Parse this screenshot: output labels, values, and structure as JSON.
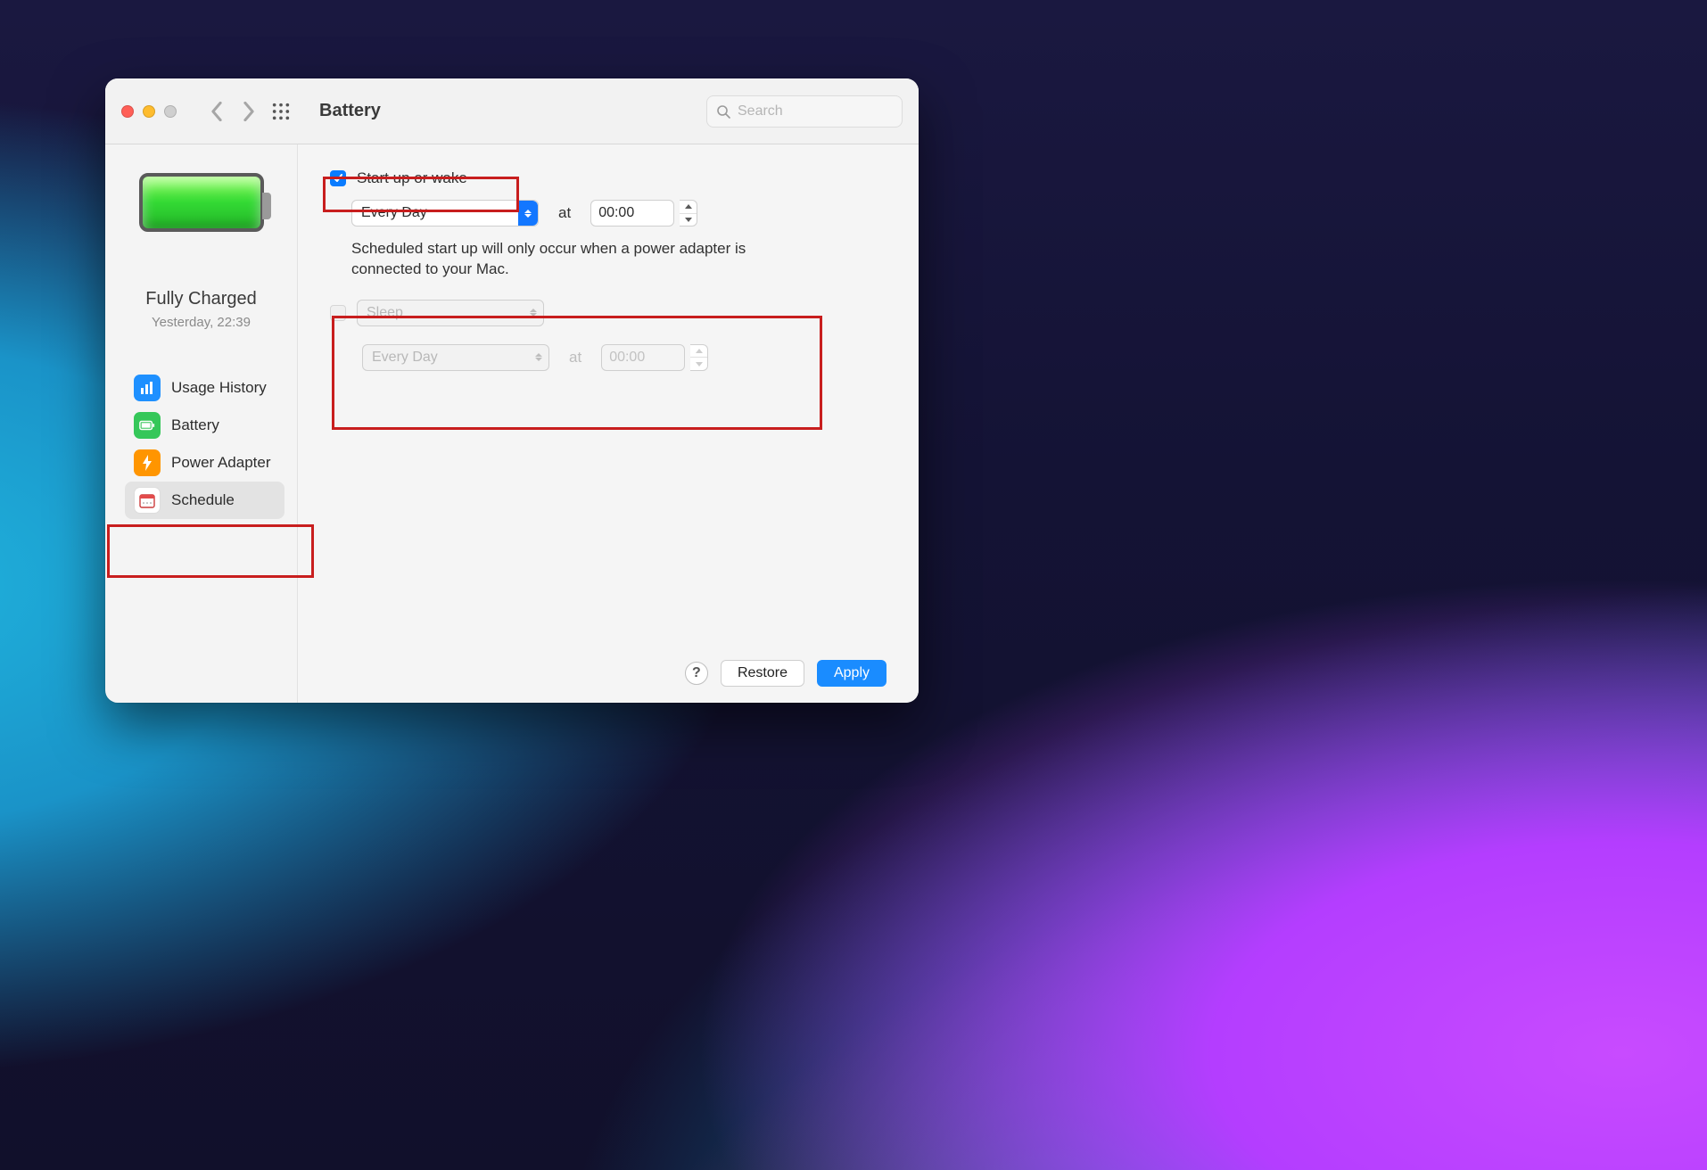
{
  "header": {
    "title": "Battery",
    "search_placeholder": "Search"
  },
  "sidebar": {
    "status_title": "Fully Charged",
    "status_sub": "Yesterday, 22:39",
    "items": [
      {
        "label": "Usage History",
        "icon": "chart-icon",
        "selected": false
      },
      {
        "label": "Battery",
        "icon": "battery-icon",
        "selected": false
      },
      {
        "label": "Power Adapter",
        "icon": "bolt-icon",
        "selected": false
      },
      {
        "label": "Schedule",
        "icon": "calendar-icon",
        "selected": true
      }
    ]
  },
  "schedule": {
    "startup": {
      "checked": true,
      "label": "Start up or wake",
      "frequency": "Every Day",
      "at_label": "at",
      "time": "00:00",
      "note": "Scheduled start up will only occur when a power adapter is connected to your Mac."
    },
    "sleep": {
      "checked": false,
      "mode": "Sleep",
      "frequency": "Every Day",
      "at_label": "at",
      "time": "00:00"
    }
  },
  "footer": {
    "help_label": "?",
    "restore": "Restore",
    "apply": "Apply"
  }
}
